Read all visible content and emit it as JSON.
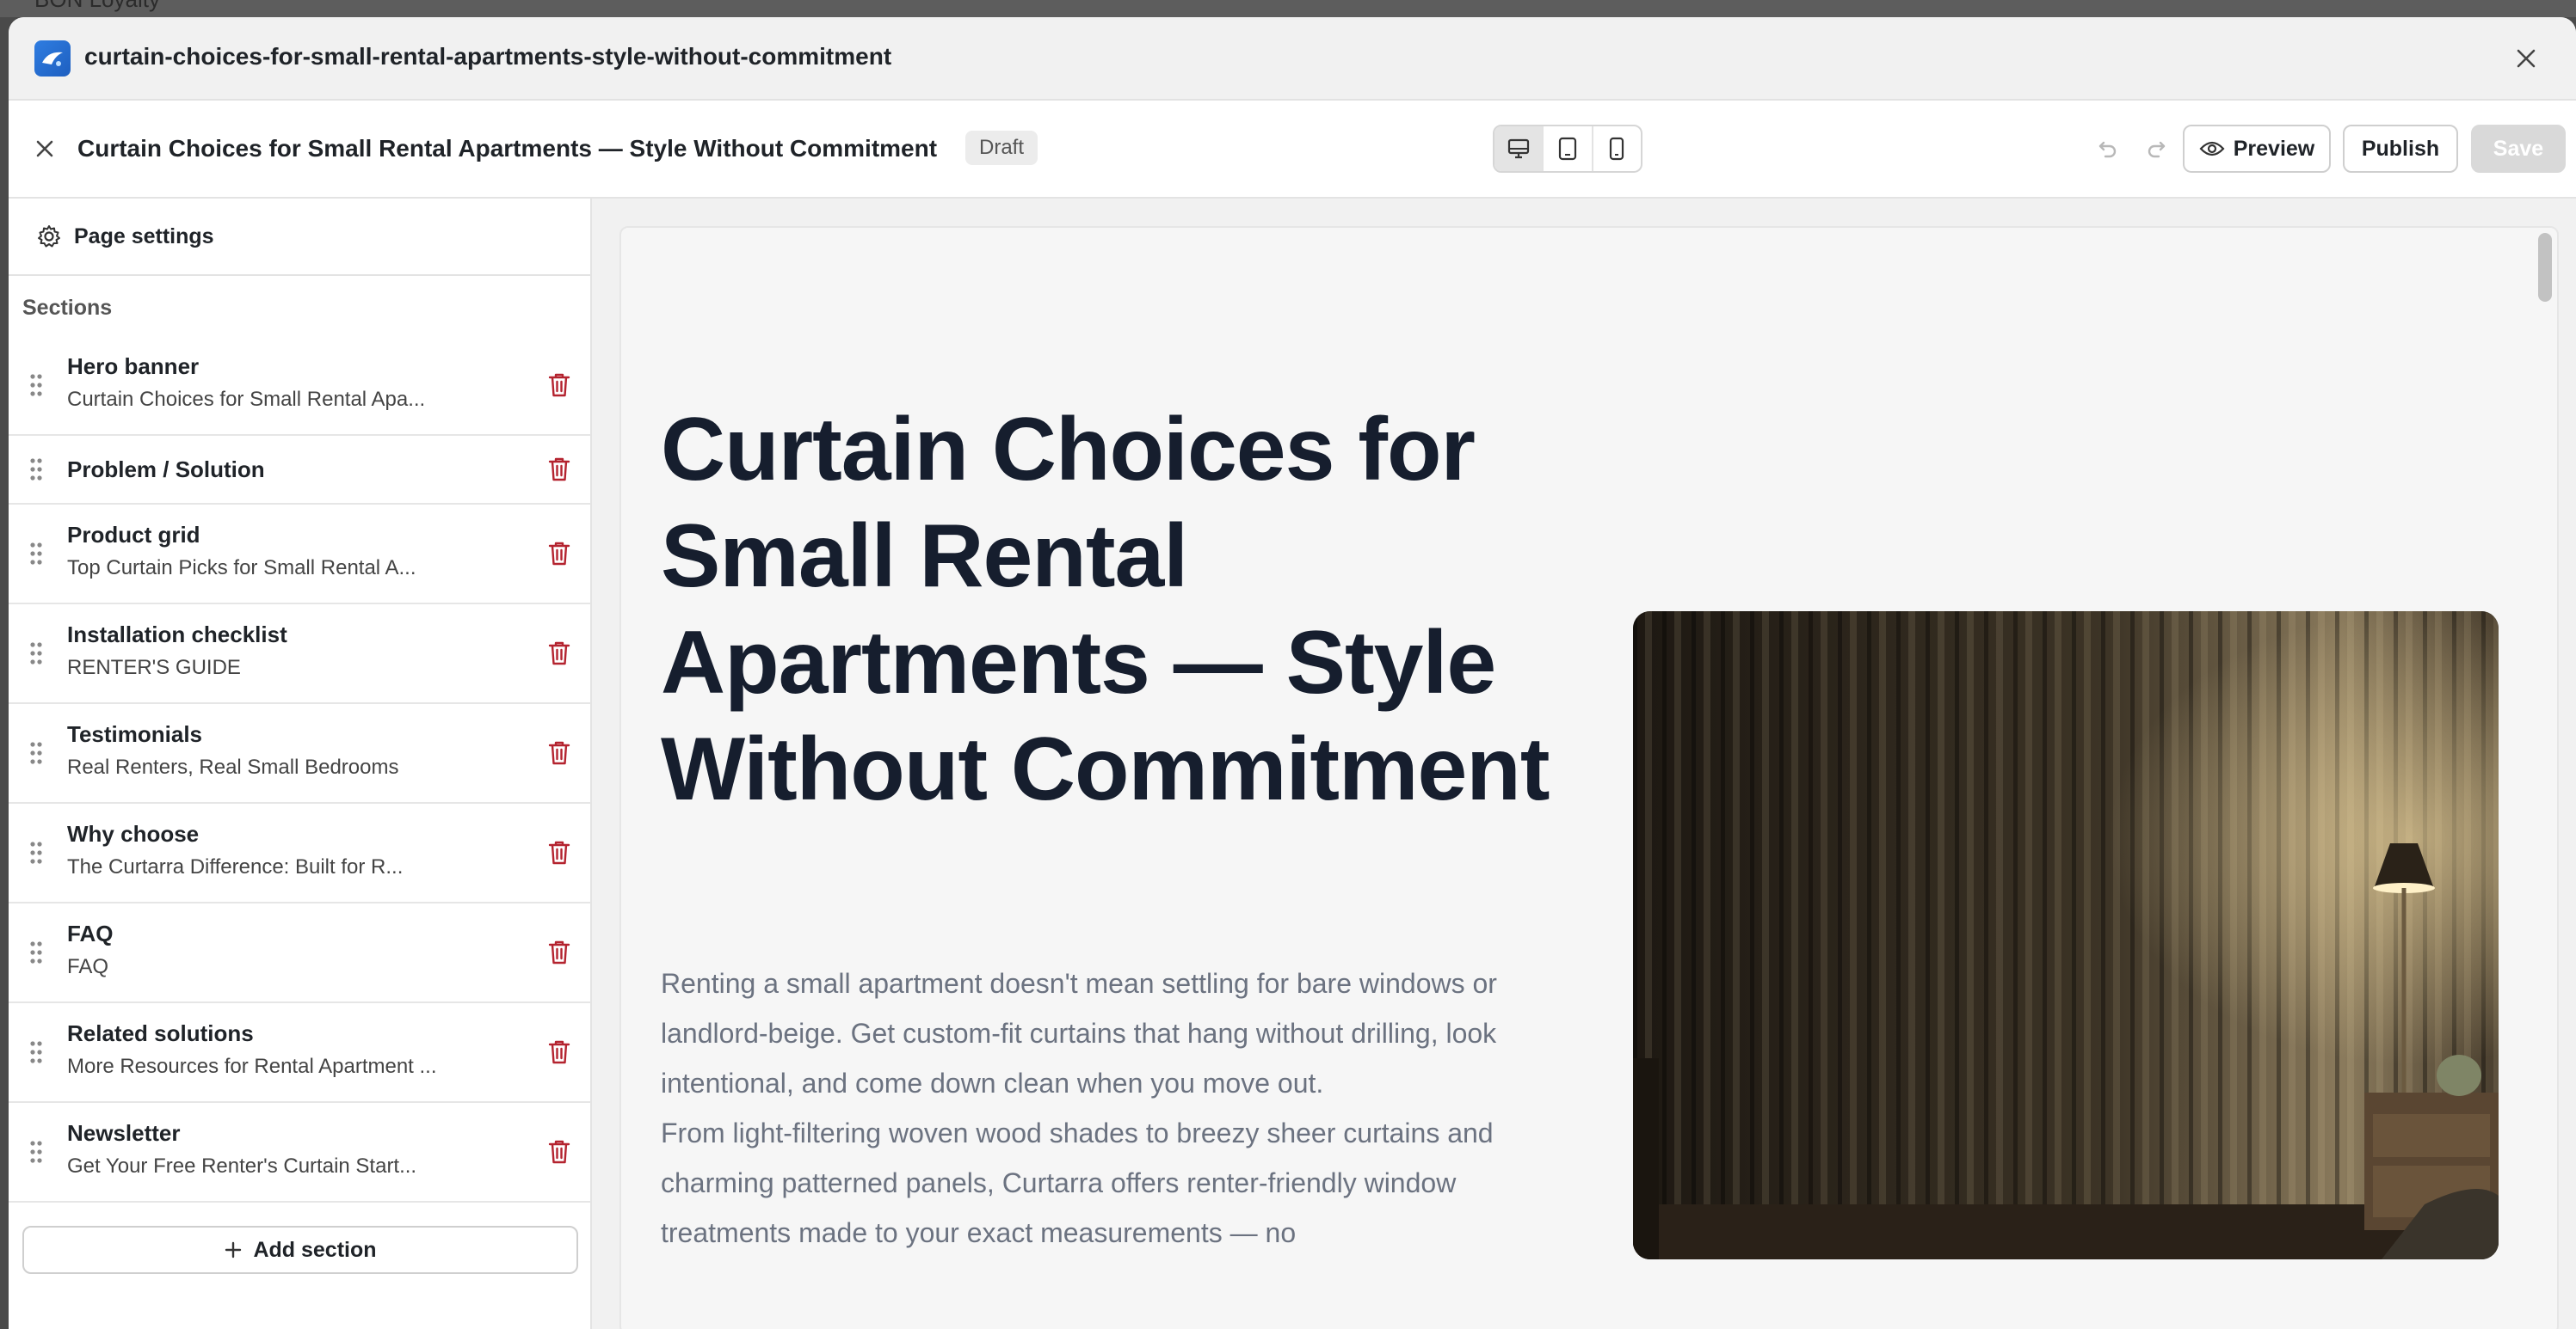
{
  "background_app": {
    "label": "BON Loyalty"
  },
  "window": {
    "title": "curtain-choices-for-small-rental-apartments-style-without-commitment"
  },
  "toolbar": {
    "page_title": "Curtain Choices for Small Rental Apartments — Style Without Commitment",
    "status_badge": "Draft",
    "preview_label": "Preview",
    "publish_label": "Publish",
    "save_label": "Save"
  },
  "sidebar": {
    "page_settings_label": "Page settings",
    "sections_heading": "Sections",
    "sections": [
      {
        "title": "Hero banner",
        "subtitle": "Curtain Choices for Small Rental Apa..."
      },
      {
        "title": "Problem / Solution",
        "subtitle": ""
      },
      {
        "title": "Product grid",
        "subtitle": "Top Curtain Picks for Small Rental A..."
      },
      {
        "title": "Installation checklist",
        "subtitle": "RENTER'S GUIDE"
      },
      {
        "title": "Testimonials",
        "subtitle": "Real Renters, Real Small Bedrooms"
      },
      {
        "title": "Why choose",
        "subtitle": "The Curtarra Difference: Built for R..."
      },
      {
        "title": "FAQ",
        "subtitle": "FAQ"
      },
      {
        "title": "Related solutions",
        "subtitle": "More Resources for Rental Apartment ..."
      },
      {
        "title": "Newsletter",
        "subtitle": "Get Your Free Renter's Curtain Start..."
      }
    ],
    "add_section_label": "Add section"
  },
  "preview": {
    "hero_title": "Curtain Choices for Small Rental Apartments — Style Without Commitment",
    "hero_paragraph_1": "Renting a small apartment doesn't mean settling for bare windows or landlord-beige. Get custom-fit curtains that hang without drilling, look intentional, and come down clean when you move out.",
    "hero_paragraph_2": "From light-filtering woven wood shades to breezy sheer curtains and charming patterned panels, Curtarra offers renter-friendly window treatments made to your exact measurements — no"
  },
  "colors": {
    "accent_trash": "#b4232f",
    "heading": "#161e2e",
    "body_text": "#6b7280",
    "save_disabled": "#d9d9d9"
  }
}
